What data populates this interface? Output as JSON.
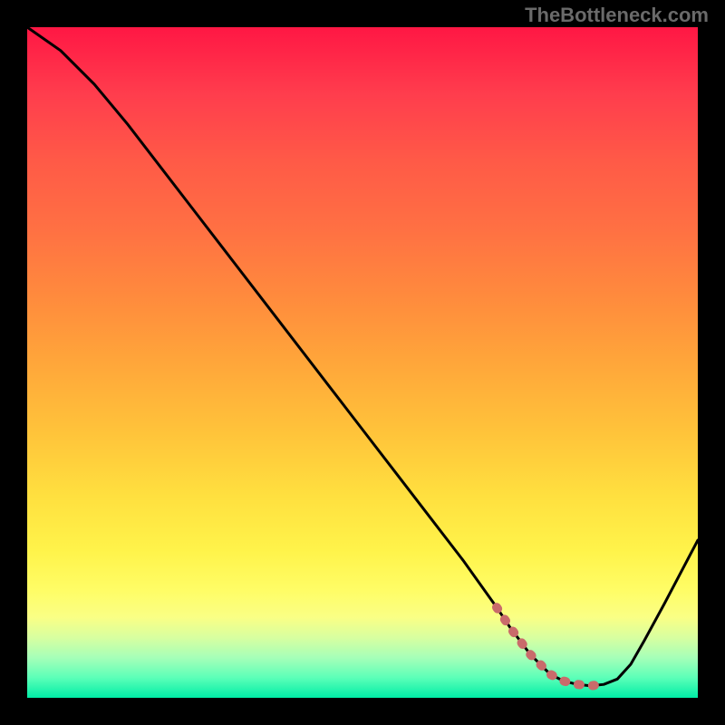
{
  "watermark": "TheBottleneck.com",
  "chart_data": {
    "type": "line",
    "title": "",
    "xlabel": "",
    "ylabel": "",
    "x": [
      0.0,
      0.05,
      0.1,
      0.15,
      0.2,
      0.25,
      0.3,
      0.35,
      0.4,
      0.45,
      0.5,
      0.55,
      0.6,
      0.65,
      0.7,
      0.72,
      0.75,
      0.78,
      0.8,
      0.82,
      0.84,
      0.86,
      0.88,
      0.9,
      0.92,
      0.95,
      1.0
    ],
    "values": [
      1.0,
      0.965,
      0.915,
      0.855,
      0.79,
      0.725,
      0.66,
      0.595,
      0.53,
      0.465,
      0.4,
      0.335,
      0.27,
      0.205,
      0.135,
      0.105,
      0.065,
      0.035,
      0.025,
      0.02,
      0.018,
      0.02,
      0.028,
      0.05,
      0.085,
      0.14,
      0.235
    ],
    "dotted_segment_x": [
      0.7,
      0.86
    ],
    "minimum_x": 0.8,
    "xlim": [
      0,
      1
    ],
    "ylim": [
      0,
      1
    ],
    "background_gradient": {
      "top": "#ff1744",
      "middle": "#ffe03f",
      "bottom": "#00eda6"
    }
  }
}
